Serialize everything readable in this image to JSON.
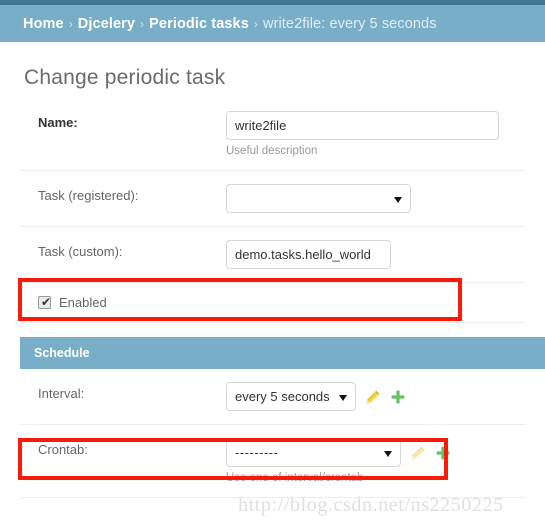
{
  "breadcrumbs": {
    "items": [
      {
        "label": "Home",
        "current": false
      },
      {
        "label": "Djcelery",
        "current": false
      },
      {
        "label": "Periodic tasks",
        "current": false
      },
      {
        "label": "write2file: every 5 seconds",
        "current": true
      }
    ],
    "separator": "›"
  },
  "page": {
    "title": "Change periodic task"
  },
  "form": {
    "name": {
      "label": "Name:",
      "value": "write2file",
      "help": "Useful description"
    },
    "task_registered": {
      "label": "Task (registered):",
      "value": "",
      "options": [
        ""
      ]
    },
    "task_custom": {
      "label": "Task (custom):",
      "value": "demo.tasks.hello_world"
    },
    "enabled": {
      "label": "Enabled",
      "checked": true,
      "tick": "✔"
    }
  },
  "schedule": {
    "header": "Schedule",
    "interval": {
      "label": "Interval:",
      "value": "every 5 seconds",
      "options": [
        "every 5 seconds"
      ],
      "edit_icon": "pencil-icon",
      "add_icon": "plus-icon"
    },
    "crontab": {
      "label": "Crontab:",
      "value": "---------",
      "options": [
        "---------"
      ],
      "edit_icon": "pencil-icon",
      "add_icon": "plus-icon",
      "help": "Use one of interval/crontab"
    }
  },
  "watermark": {
    "text": "http://blog.csdn.net/ns2250225"
  },
  "colors": {
    "header_dark": "#417690",
    "header_light": "#79aec8",
    "annotation_red": "#f91a09",
    "pencil_yellow": "#f0c419",
    "plus_green": "#63c263"
  }
}
